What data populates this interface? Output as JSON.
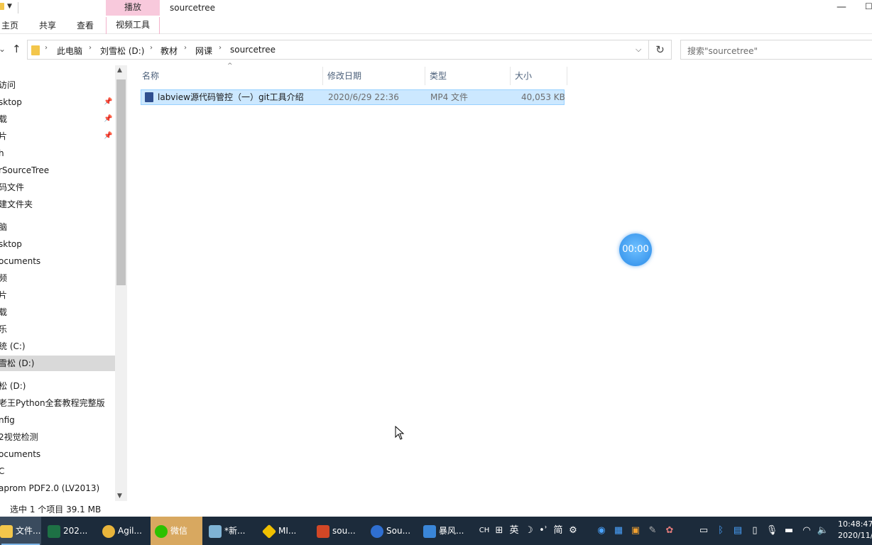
{
  "window": {
    "title": "sourcetree",
    "contextual_tab_group": "播放",
    "ribbon_tabs": [
      "主页",
      "共享",
      "查看",
      "视频工具"
    ]
  },
  "address_bar": {
    "crumbs": [
      "此电脑",
      "刘雪松 (D:)",
      "教材",
      "网课",
      "sourcetree"
    ]
  },
  "search": {
    "placeholder": "搜索\"sourcetree\""
  },
  "nav_pane": {
    "items": [
      {
        "label": "访问"
      },
      {
        "label": "sktop"
      },
      {
        "label": "载"
      },
      {
        "label": "片"
      },
      {
        "label": "h"
      },
      {
        "label": "rSourceTree"
      },
      {
        "label": "码文件"
      },
      {
        "label": "建文件夹"
      },
      {
        "label": "脑"
      },
      {
        "label": "sktop"
      },
      {
        "label": "ocuments"
      },
      {
        "label": "频"
      },
      {
        "label": "片"
      },
      {
        "label": "载"
      },
      {
        "label": "乐"
      },
      {
        "label": "统 (C:)"
      },
      {
        "label": "雪松 (D:)"
      },
      {
        "label": "松 (D:)"
      },
      {
        "label": "老王Python全套教程完整版"
      },
      {
        "label": "nfig"
      },
      {
        "label": "2视觉检测"
      },
      {
        "label": "ocuments"
      },
      {
        "label": "C"
      },
      {
        "label": "aprom PDF2.0 (LV2013)"
      }
    ]
  },
  "file_list": {
    "columns": [
      "名称",
      "修改日期",
      "类型",
      "大小"
    ],
    "rows": [
      {
        "name": "labview源代码管控（一）git工具介绍",
        "modified": "2020/6/29 22:36",
        "type": "MP4 文件",
        "size": "40,053 KB"
      }
    ]
  },
  "timer": "00:00",
  "status_bar": {
    "selection": "选中 1 个项目  39.1 MB"
  },
  "taskbar": {
    "apps": [
      {
        "label": "文件..."
      },
      {
        "label": "202..."
      },
      {
        "label": "Agil..."
      },
      {
        "label": "微信"
      },
      {
        "label": "*新..."
      },
      {
        "label": "MI..."
      },
      {
        "label": "sou..."
      },
      {
        "label": "Sou..."
      },
      {
        "label": "暴风..."
      }
    ],
    "ime": {
      "lang": "CH",
      "mode": "英",
      "simp": "简"
    },
    "clock": {
      "time": "10:48:47",
      "date": "2020/11/"
    }
  }
}
